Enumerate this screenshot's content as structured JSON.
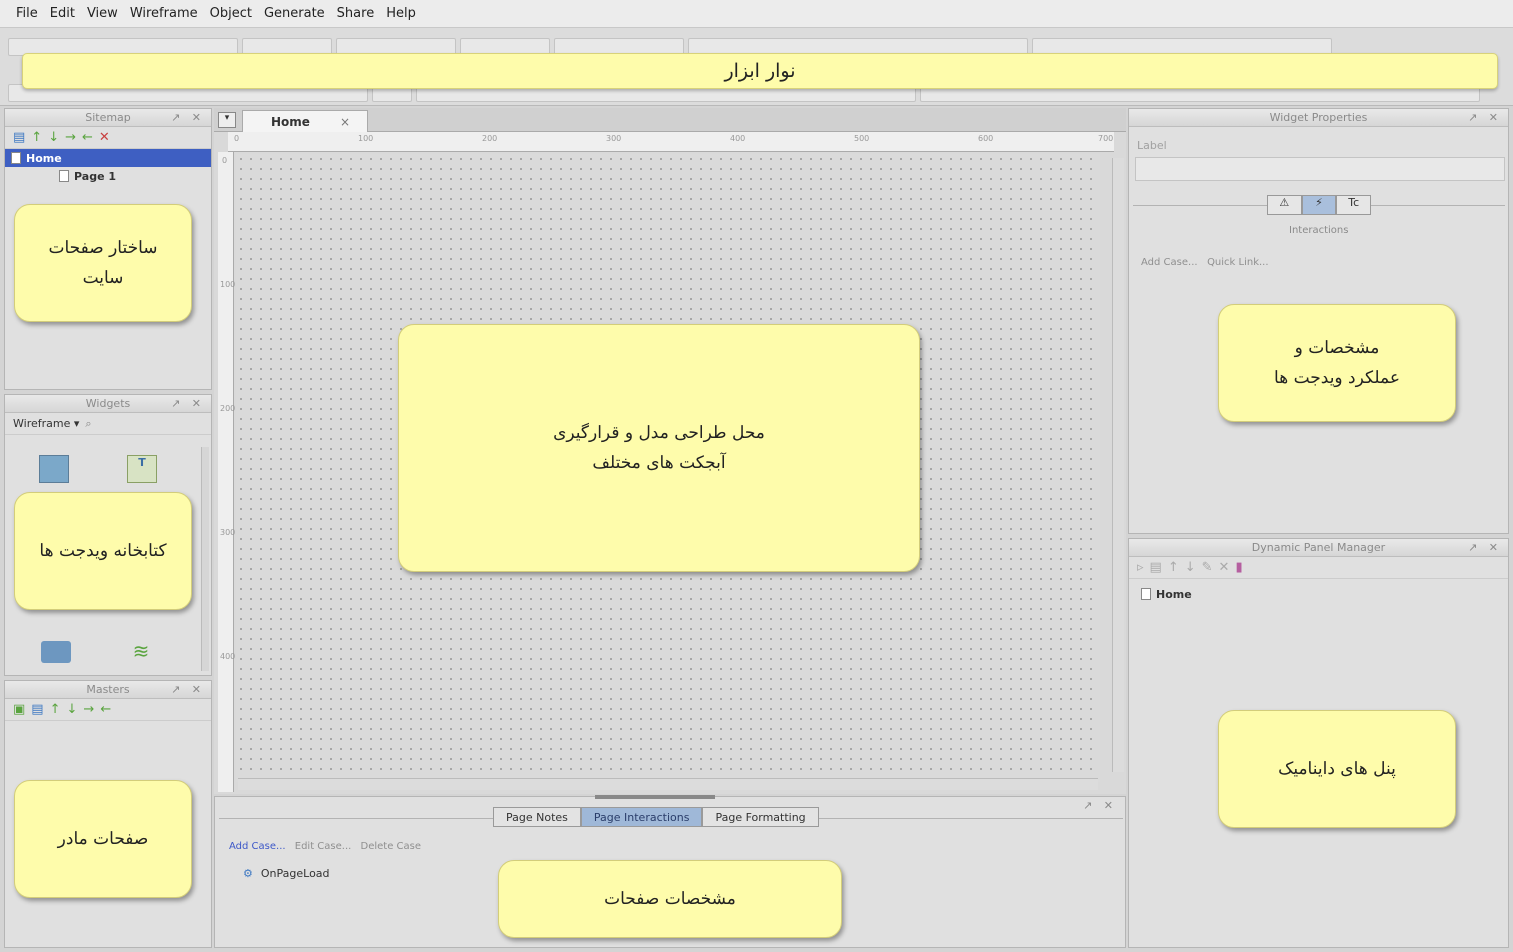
{
  "menu": [
    "File",
    "Edit",
    "View",
    "Wireframe",
    "Object",
    "Generate",
    "Share",
    "Help"
  ],
  "toolbar": {
    "annotation": "نوار ابزار"
  },
  "sitemap": {
    "title": "Sitemap",
    "items": [
      "Home",
      "Page 1"
    ],
    "annotation_line1": "ساختار صفحات",
    "annotation_line2": "سایت"
  },
  "widgets": {
    "title": "Widgets",
    "library": "Wireframe",
    "annotation": "کتابخانه ویدجت ها"
  },
  "masters": {
    "title": "Masters",
    "annotation": "صفحات مادر"
  },
  "canvas": {
    "tab": "Home",
    "ruler_top": [
      "0",
      "100",
      "200",
      "300",
      "400",
      "500",
      "600",
      "700"
    ],
    "ruler_left": [
      "0",
      "100",
      "200",
      "300",
      "400"
    ],
    "annotation_line1": "محل طراحی مدل و قرارگیری",
    "annotation_line2": "آبجکت های مختلف"
  },
  "widget_properties": {
    "title": "Widget Properties",
    "label_field": "Label",
    "section": "Interactions",
    "add_case": "Add Case...",
    "quick_link": "Quick Link...",
    "annotation_line1": "مشخصات و",
    "annotation_line2": "عملکرد ویدجت ها"
  },
  "dynamic_panel": {
    "title": "Dynamic Panel Manager",
    "item": "Home",
    "annotation": "پنل های داینامیک"
  },
  "page_properties": {
    "tabs": [
      "Page Notes",
      "Page Interactions",
      "Page Formatting"
    ],
    "active_tab": "Page Interactions",
    "add_case": "Add Case...",
    "edit_case": "Edit Case...",
    "delete_case": "Delete Case",
    "event": "OnPageLoad",
    "annotation": "مشخصات صفحات"
  },
  "colors": {
    "callout": "#fefcab",
    "selection": "#3e5fc2",
    "link": "#3d58c8"
  }
}
